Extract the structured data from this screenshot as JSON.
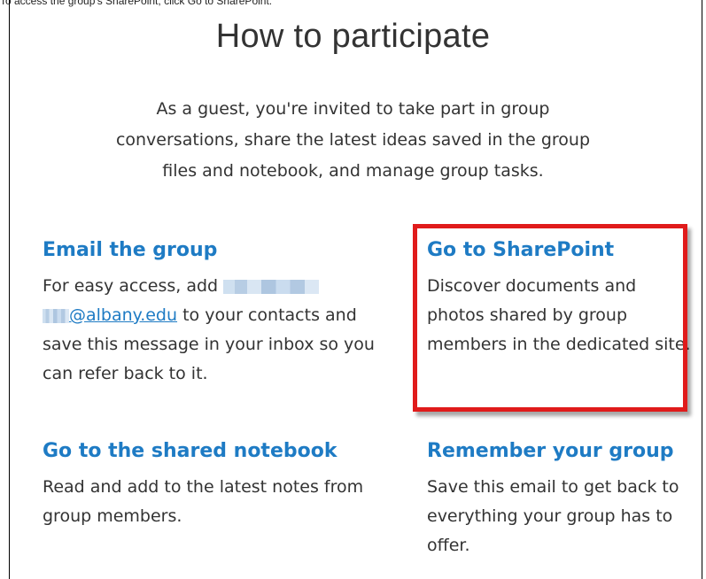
{
  "caption": "To access the group's SharePoint, click Go to SharePoint:",
  "title": "How to participate",
  "intro": "As a guest, you're invited to take part in group conversations, share the latest ideas saved in the group files and notebook, and manage group tasks.",
  "cards": {
    "email": {
      "heading": "Email the group",
      "text_before": "For easy access, add",
      "link": "@albany.edu",
      "text_after": "to your contacts and save this message in your inbox so you can refer back to it."
    },
    "sharepoint": {
      "heading": "Go to SharePoint",
      "text": "Discover documents and photos shared by group members in the dedicated site."
    },
    "notebook": {
      "heading": "Go to the shared notebook",
      "text": "Read and add to the latest notes from group members."
    },
    "remember": {
      "heading": "Remember your group",
      "text": "Save this email to get back to everything your group has to offer."
    }
  },
  "colors": {
    "link": "#1e7bc4",
    "highlight": "#e01b1b",
    "body_text": "#333333"
  }
}
